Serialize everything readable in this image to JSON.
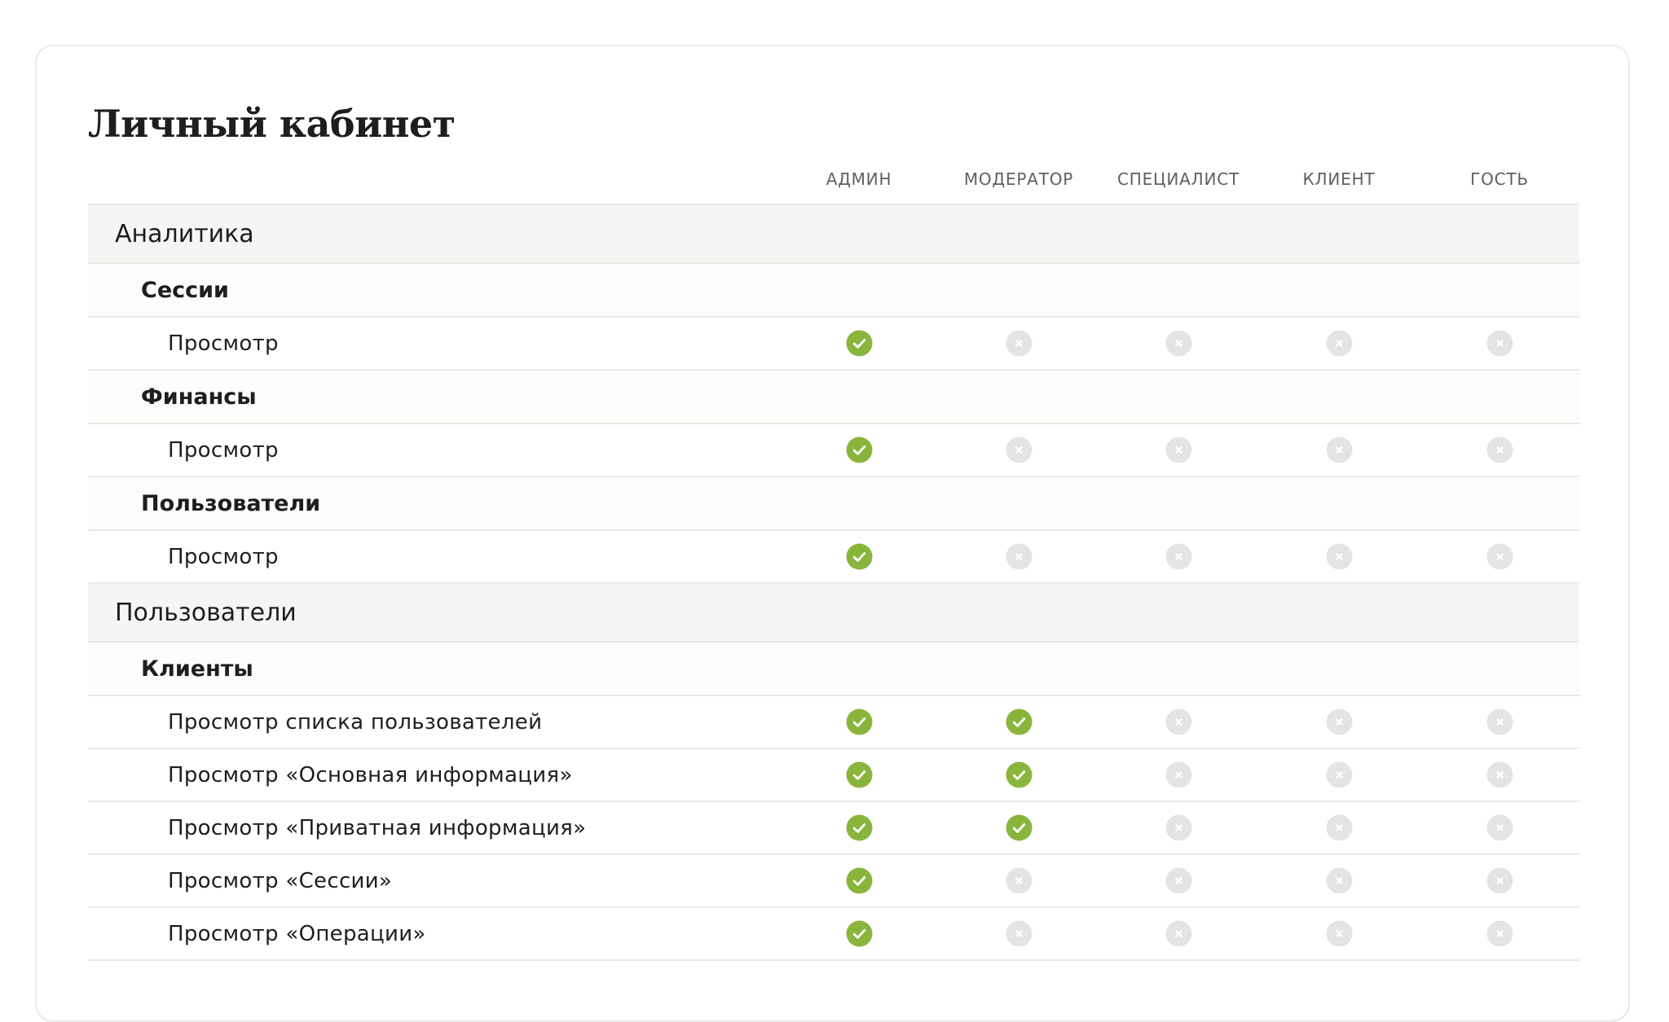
{
  "page": {
    "title": "Личный кабинет"
  },
  "columns": [
    "АДМИН",
    "МОДЕРАТОР",
    "СПЕЦИАЛИСТ",
    "КЛИЕНТ",
    "ГОСТЬ"
  ],
  "colors": {
    "granted": "#8ab53d",
    "denied": "#e4e4e2",
    "group_bg": "#f5f5f3",
    "subgroup_bg": "#fcfcfa",
    "border": "#e9e9e6",
    "text": "#1e1e1e",
    "header_text": "#5f5f5f"
  },
  "icons": {
    "granted": "check-circle-icon",
    "denied": "x-circle-icon"
  },
  "rows": [
    {
      "type": "group",
      "label": "Аналитика"
    },
    {
      "type": "subgroup",
      "label": "Сессии"
    },
    {
      "type": "perm",
      "label": "Просмотр",
      "access": [
        true,
        false,
        false,
        false,
        false
      ]
    },
    {
      "type": "subgroup",
      "label": "Финансы"
    },
    {
      "type": "perm",
      "label": "Просмотр",
      "access": [
        true,
        false,
        false,
        false,
        false
      ]
    },
    {
      "type": "subgroup",
      "label": "Пользователи"
    },
    {
      "type": "perm",
      "label": "Просмотр",
      "access": [
        true,
        false,
        false,
        false,
        false
      ]
    },
    {
      "type": "group",
      "label": "Пользователи"
    },
    {
      "type": "subgroup",
      "label": "Клиенты"
    },
    {
      "type": "perm",
      "label": "Просмотр списка пользователей",
      "access": [
        true,
        true,
        false,
        false,
        false
      ]
    },
    {
      "type": "perm",
      "label": "Просмотр «Основная информация»",
      "access": [
        true,
        true,
        false,
        false,
        false
      ]
    },
    {
      "type": "perm",
      "label": "Просмотр «Приватная информация»",
      "access": [
        true,
        true,
        false,
        false,
        false
      ]
    },
    {
      "type": "perm",
      "label": "Просмотр «Сессии»",
      "access": [
        true,
        false,
        false,
        false,
        false
      ]
    },
    {
      "type": "perm",
      "label": "Просмотр «Операции»",
      "access": [
        true,
        false,
        false,
        false,
        false
      ]
    }
  ]
}
